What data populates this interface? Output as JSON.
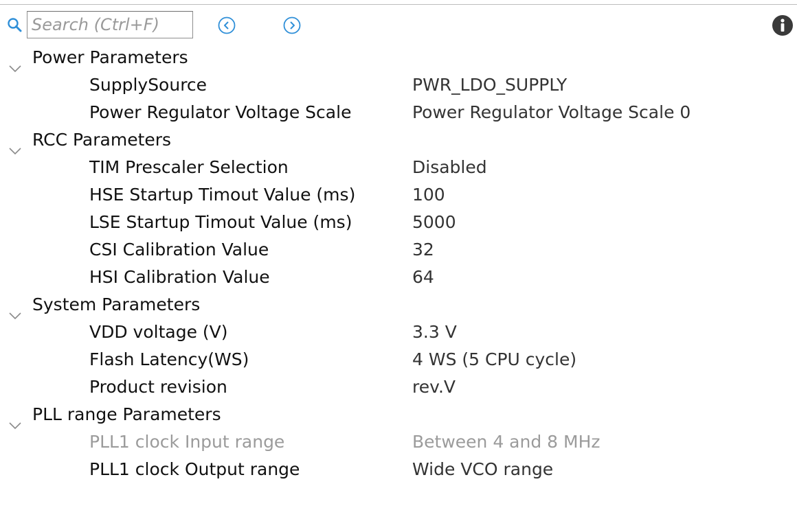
{
  "search": {
    "placeholder": "Search (Ctrl+F)"
  },
  "icons": {
    "search": "search-icon",
    "prev": "circle-chevron-left-icon",
    "next": "circle-chevron-right-icon",
    "info": "info-icon",
    "expand": "chevron-down-icon"
  },
  "colors": {
    "accent_blue": "#2f8fd8",
    "info_dark": "#3a3a3a",
    "text_disabled": "#9b9b9b"
  },
  "groups": [
    {
      "label": "Power Parameters",
      "params": [
        {
          "name": "SupplySource",
          "value": "PWR_LDO_SUPPLY"
        },
        {
          "name": "Power Regulator Voltage Scale",
          "value": "Power Regulator Voltage Scale 0"
        }
      ]
    },
    {
      "label": "RCC Parameters",
      "params": [
        {
          "name": "TIM Prescaler Selection",
          "value": "Disabled"
        },
        {
          "name": "HSE Startup Timout Value (ms)",
          "value": "100"
        },
        {
          "name": "LSE Startup Timout Value (ms)",
          "value": "5000"
        },
        {
          "name": "CSI Calibration Value",
          "value": "32"
        },
        {
          "name": "HSI Calibration Value",
          "value": "64"
        }
      ]
    },
    {
      "label": "System Parameters",
      "params": [
        {
          "name": "VDD voltage (V)",
          "value": "3.3 V"
        },
        {
          "name": "Flash Latency(WS)",
          "value": "4 WS (5 CPU cycle)"
        },
        {
          "name": "Product revision",
          "value": "rev.V"
        }
      ]
    },
    {
      "label": "PLL range Parameters",
      "params": [
        {
          "name": "PLL1 clock Input range",
          "value": "Between 4 and 8 MHz",
          "disabled": true
        },
        {
          "name": "PLL1 clock Output range",
          "value": "Wide VCO range"
        }
      ]
    }
  ]
}
